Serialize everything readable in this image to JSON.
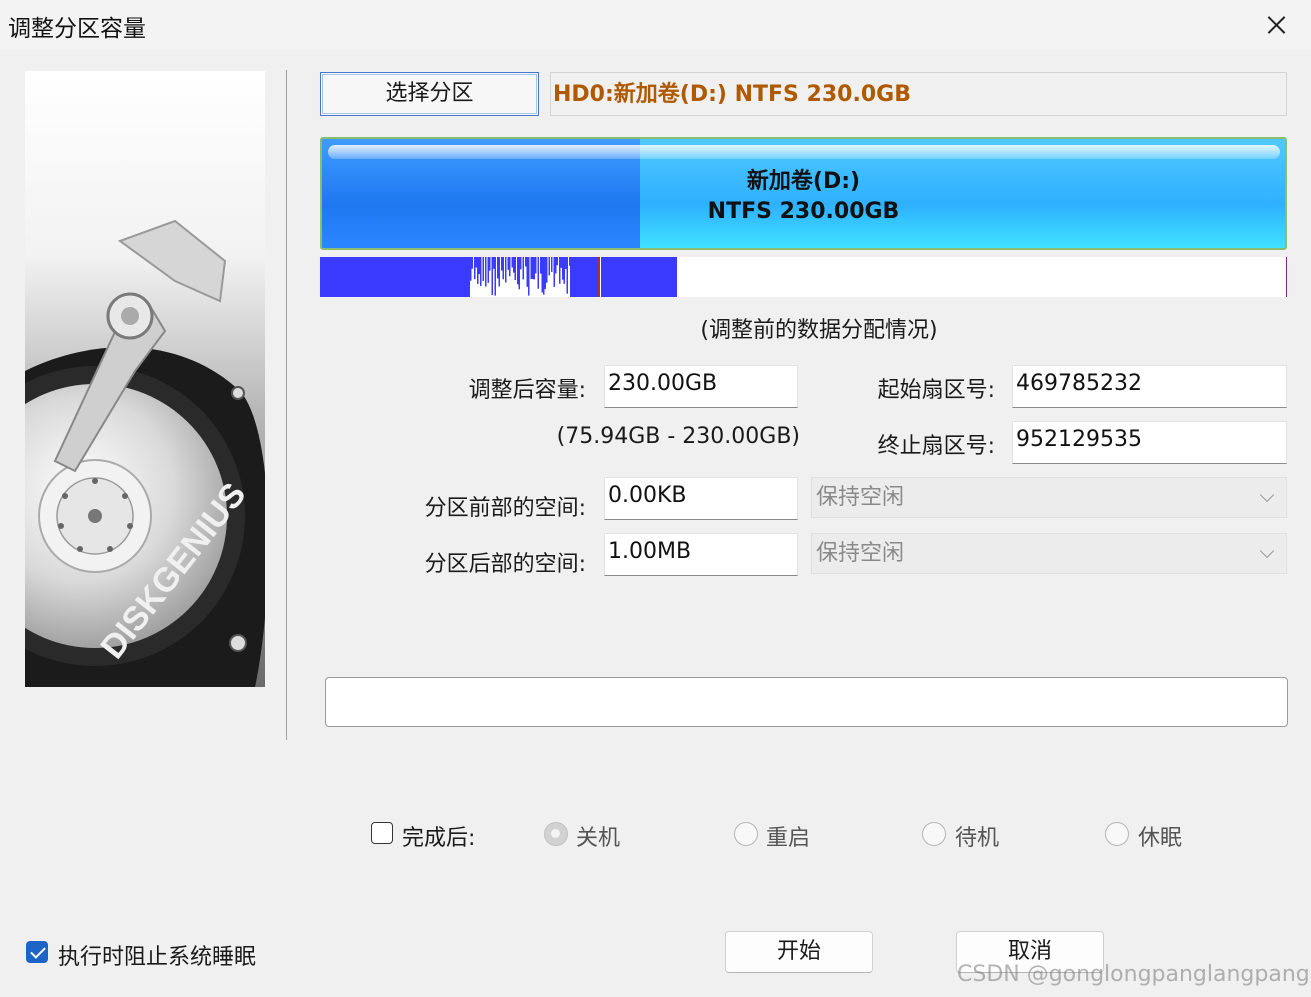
{
  "window": {
    "title": "调整分区容量"
  },
  "side_image": {
    "brand_text": "DISKGENIUS"
  },
  "partition_selector": {
    "button_label": "选择分区",
    "info": "HD0:新加卷(D:) NTFS 230.0GB",
    "info_color": "#b05a00"
  },
  "partition_bar": {
    "name": "新加卷(D:)",
    "detail": "NTFS 230.00GB",
    "used_fraction": 0.33
  },
  "data_map": {
    "caption": "(调整前的数据分配情况)",
    "fill_color": "#3b3bff"
  },
  "form": {
    "new_size_label": "调整后容量:",
    "new_size_value": "230.00GB",
    "size_range": "(75.94GB - 230.00GB)",
    "start_sector_label": "起始扇区号:",
    "start_sector_value": "469785232",
    "end_sector_label": "终止扇区号:",
    "end_sector_value": "952129535",
    "space_before_label": "分区前部的空间:",
    "space_before_value": "0.00KB",
    "space_before_option": "保持空闲",
    "space_after_label": "分区后部的空间:",
    "space_after_value": "1.00MB",
    "space_after_option": "保持空闲"
  },
  "completion": {
    "checkbox_label": "完成后:",
    "checked": false,
    "options": [
      "关机",
      "重启",
      "待机",
      "休眠"
    ],
    "selected": "关机"
  },
  "prevent_sleep": {
    "label": "执行时阻止系统睡眠",
    "checked": true
  },
  "buttons": {
    "start": "开始",
    "cancel": "取消"
  },
  "watermark": "CSDN @gonglongpanglangpang"
}
